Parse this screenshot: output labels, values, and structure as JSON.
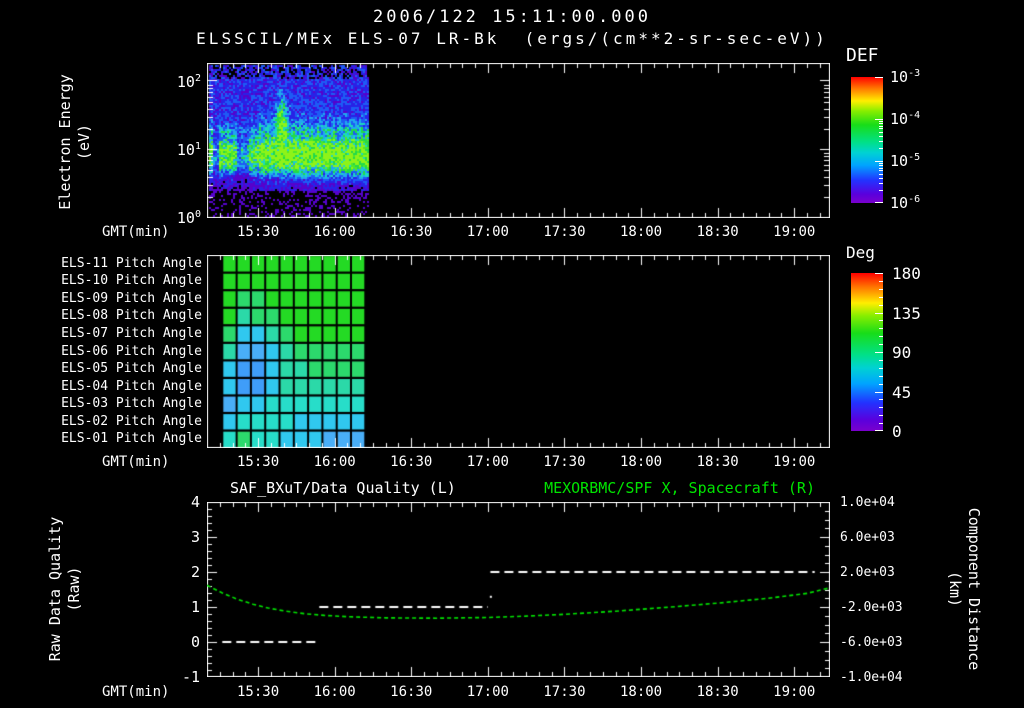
{
  "header": {
    "title": "2006/122 15:11:00.000",
    "subtitle": "ELSSCIL/MEx ELS-07 LR-Bk  (ergs/(cm**2-sr-sec-eV))"
  },
  "time_axis": {
    "label": "GMT(min)",
    "start": "15:10",
    "end": "19:14",
    "major_ticks": [
      "15:30",
      "16:00",
      "16:30",
      "17:00",
      "17:30",
      "18:00",
      "18:30",
      "19:00"
    ],
    "minor_step_min": 5
  },
  "energy_panel": {
    "ylabel_line1": "Electron Energy",
    "ylabel_line2": "(eV)",
    "ytick_exponents": [
      2,
      1,
      0
    ],
    "data_start": "15:11",
    "data_end": "16:13",
    "colorbar": {
      "title": "DEF",
      "tick_exponents": [
        -3,
        -4,
        -5,
        -6
      ]
    }
  },
  "pitch_panel": {
    "row_labels": [
      "ELS-11 Pitch Angle",
      "ELS-10 Pitch Angle",
      "ELS-09 Pitch Angle",
      "ELS-08 Pitch Angle",
      "ELS-07 Pitch Angle",
      "ELS-06 Pitch Angle",
      "ELS-05 Pitch Angle",
      "ELS-04 Pitch Angle",
      "ELS-03 Pitch Angle",
      "ELS-02 Pitch Angle",
      "ELS-01 Pitch Angle"
    ],
    "colorbar": {
      "title": "Deg",
      "ticks": [
        "180",
        "135",
        "90",
        "45",
        "0"
      ]
    },
    "data_start": "15:16",
    "data_end": "16:12",
    "palette": {
      "G": "#24da24",
      "E": "#2cd96c",
      "T": "#2bd9a8",
      "Q": "#27ddc9",
      "C": "#30c8ef",
      "L": "#49aef7",
      "B": "#3f9df9"
    },
    "grid": [
      [
        "G",
        "G",
        "G",
        "G",
        "G",
        "G",
        "G",
        "G",
        "G",
        "G"
      ],
      [
        "G",
        "G",
        "G",
        "G",
        "G",
        "G",
        "G",
        "G",
        "G",
        "G"
      ],
      [
        "G",
        "E",
        "E",
        "G",
        "G",
        "G",
        "G",
        "G",
        "G",
        "G"
      ],
      [
        "G",
        "T",
        "E",
        "E",
        "G",
        "G",
        "G",
        "G",
        "G",
        "G"
      ],
      [
        "E",
        "C",
        "C",
        "T",
        "E",
        "G",
        "G",
        "G",
        "G",
        "G"
      ],
      [
        "T",
        "L",
        "L",
        "C",
        "T",
        "E",
        "E",
        "E",
        "E",
        "E"
      ],
      [
        "C",
        "B",
        "B",
        "C",
        "T",
        "T",
        "E",
        "E",
        "E",
        "E"
      ],
      [
        "C",
        "B",
        "B",
        "C",
        "T",
        "T",
        "T",
        "T",
        "T",
        "T"
      ],
      [
        "L",
        "C",
        "C",
        "Q",
        "Q",
        "Q",
        "Q",
        "Q",
        "Q",
        "Q"
      ],
      [
        "C",
        "Q",
        "Q",
        "Q",
        "Q",
        "C",
        "C",
        "C",
        "C",
        "C"
      ],
      [
        "Q",
        "E",
        "Q",
        "Q",
        "C",
        "C",
        "C",
        "L",
        "L",
        "L"
      ]
    ]
  },
  "quality_panel": {
    "title_left": "SAF_BXuT/Data Quality (L)",
    "title_right": "MEXORBMC/SPF X, Spacecraft (R)",
    "ylabel_line1": "Raw Data Quality",
    "ylabel_line2": "(Raw)",
    "left_ticks": [
      "4",
      "3",
      "2",
      "1",
      "0",
      "-1"
    ],
    "right_ticks": [
      "1.0e+04",
      "6.0e+03",
      "2.0e+03",
      "-2.0e+03",
      "-6.0e+03",
      "-1.0e+04"
    ],
    "right_label_line1": "Component Distance",
    "right_label_line2": "(km)",
    "accent_green": "#00e400",
    "quality_segments": [
      {
        "start": "15:16",
        "end": "15:53",
        "value": 0
      },
      {
        "start": "15:54",
        "end": "17:00",
        "value": 1
      },
      {
        "start": "17:01",
        "end": "19:08",
        "value": 2
      }
    ],
    "distance_points": [
      [
        "15:10",
        1.62
      ],
      [
        "15:16",
        1.4
      ],
      [
        "15:22",
        1.22
      ],
      [
        "15:28",
        1.08
      ],
      [
        "15:34",
        0.97
      ],
      [
        "15:40",
        0.89
      ],
      [
        "15:48",
        0.81
      ],
      [
        "15:56",
        0.76
      ],
      [
        "16:06",
        0.72
      ],
      [
        "16:20",
        0.69
      ],
      [
        "16:40",
        0.68
      ],
      [
        "17:00",
        0.7
      ],
      [
        "17:15",
        0.74
      ],
      [
        "17:30",
        0.79
      ],
      [
        "17:50",
        0.88
      ],
      [
        "18:10",
        0.99
      ],
      [
        "18:30",
        1.11
      ],
      [
        "18:50",
        1.25
      ],
      [
        "19:05",
        1.39
      ],
      [
        "19:14",
        1.55
      ]
    ]
  },
  "chart_data": [
    {
      "type": "heatmap",
      "title": "ELSSCIL/MEx ELS-07 LR-Bk (ergs/(cm**2-sr-sec-eV))",
      "datetime": "2006/122 15:11:00.000",
      "xlabel": "GMT(min)",
      "x_range": [
        "15:10",
        "19:14"
      ],
      "x_ticks": [
        "15:30",
        "16:00",
        "16:30",
        "17:00",
        "17:30",
        "18:00",
        "18:30",
        "19:00"
      ],
      "ylabel": "Electron Energy (eV)",
      "y_scale": "log",
      "y_ticks": [
        1,
        10,
        100
      ],
      "colorbar_label": "DEF",
      "colorbar_scale": "log",
      "colorbar_ticks": [
        0.001,
        0.0001,
        1e-05,
        1e-06
      ],
      "data_coverage": [
        "15:11",
        "16:13"
      ],
      "features": [
        "broad green flux band (~1e-4) between ~4 and ~30 eV across the covered interval",
        "blue low-flux noise (~1e-6 to 1e-5) above and below the band, black with purple specks at extremes",
        "dark vertical dropout streaks near 15:13 and 15:21-15:27",
        "enhanced plume reaching ~60 eV near 15:38-15:42",
        "no data after ~16:13"
      ]
    },
    {
      "type": "heatmap",
      "title": "ELS anode pitch angles",
      "xlabel": "GMT(min)",
      "x_range": [
        "15:16",
        "16:12"
      ],
      "rows": [
        "ELS-11",
        "ELS-10",
        "ELS-09",
        "ELS-08",
        "ELS-07",
        "ELS-06",
        "ELS-05",
        "ELS-04",
        "ELS-03",
        "ELS-02",
        "ELS-01"
      ],
      "columns": 10,
      "colorbar_label": "Deg",
      "colorbar_range": [
        0,
        180
      ],
      "colorbar_ticks": [
        180,
        135,
        90,
        45,
        0
      ],
      "values_deg": [
        [
          115,
          115,
          115,
          115,
          115,
          115,
          115,
          115,
          115,
          115
        ],
        [
          115,
          115,
          115,
          115,
          115,
          115,
          115,
          115,
          115,
          115
        ],
        [
          115,
          100,
          100,
          115,
          115,
          115,
          115,
          115,
          115,
          115
        ],
        [
          115,
          90,
          100,
          100,
          115,
          115,
          115,
          115,
          115,
          115
        ],
        [
          100,
          74,
          74,
          90,
          100,
          115,
          115,
          115,
          115,
          115
        ],
        [
          90,
          66,
          66,
          74,
          90,
          100,
          100,
          100,
          100,
          100
        ],
        [
          74,
          62,
          62,
          74,
          90,
          90,
          100,
          100,
          100,
          100
        ],
        [
          74,
          62,
          62,
          74,
          90,
          90,
          90,
          90,
          90,
          90
        ],
        [
          66,
          74,
          74,
          82,
          82,
          82,
          82,
          82,
          82,
          82
        ],
        [
          74,
          82,
          82,
          82,
          82,
          74,
          74,
          74,
          74,
          74
        ],
        [
          82,
          100,
          82,
          82,
          74,
          74,
          74,
          66,
          66,
          66
        ]
      ]
    },
    {
      "type": "line",
      "title_left": "SAF_BXuT/Data Quality (L)",
      "title_right": "MEXORBMC/SPF X, Spacecraft (R)",
      "xlabel": "GMT(min)",
      "x_range": [
        "15:10",
        "19:14"
      ],
      "left_axis": {
        "label": "Raw Data Quality (Raw)",
        "range": [
          -1,
          4
        ]
      },
      "right_axis": {
        "label": "Component Distance (km)",
        "range": [
          -10000,
          10000
        ]
      },
      "series": [
        {
          "name": "SAF_BXuT/Data Quality",
          "axis": "left",
          "color": "#ffffff",
          "style": "dashed horizontal steps",
          "points": [
            [
              "15:16",
              0
            ],
            [
              "15:53",
              0
            ],
            [
              "15:54",
              1
            ],
            [
              "17:00",
              1
            ],
            [
              "17:01",
              2
            ],
            [
              "19:08",
              2
            ]
          ]
        },
        {
          "name": "MEXORBMC/SPF X Spacecraft distance",
          "axis": "right",
          "color": "#00e400",
          "style": "dashed curve",
          "points_km": [
            [
              "15:10",
              480
            ],
            [
              "15:22",
              -1120
            ],
            [
              "15:34",
              -2120
            ],
            [
              "15:48",
              -2760
            ],
            [
              "16:06",
              -3120
            ],
            [
              "16:40",
              -3280
            ],
            [
              "17:00",
              -3200
            ],
            [
              "17:30",
              -2840
            ],
            [
              "18:10",
              -2040
            ],
            [
              "18:50",
              -1000
            ],
            [
              "19:14",
              200
            ]
          ]
        }
      ]
    }
  ]
}
